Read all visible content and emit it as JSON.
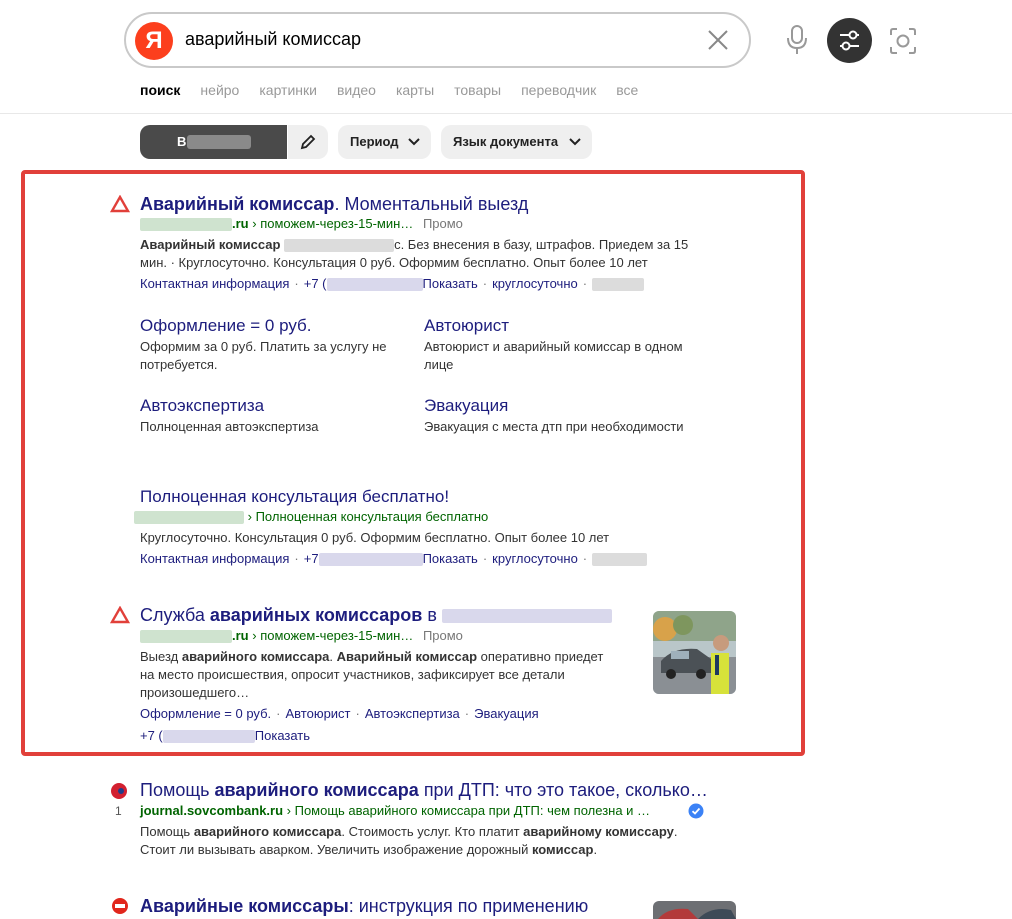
{
  "search": {
    "logo": "Я",
    "query": "аварийный комиссар"
  },
  "tabs": [
    "поиск",
    "нейро",
    "картинки",
    "видео",
    "карты",
    "товары",
    "переводчик",
    "все"
  ],
  "filters": {
    "region_prefix": "В",
    "period": "Период",
    "language": "Язык документа"
  },
  "ad1": {
    "title_bold": "Аварийный комиссар",
    "title_rest": ". Моментальный выезд",
    "url_domain_tail": ".ru",
    "url_path": "› поможем-через-15-мин…",
    "promo": "Промо",
    "text_bold": "Аварийный комиссар",
    "text_mid": "с. Без внесения в базу, штрафов. Приедем за 15",
    "text_line2": "мин. · Круглосуточно. Консультация 0 руб. Оформим бесплатно. Опыт более 10 лет",
    "contact": "Контактная информация",
    "phone_prefix": "+7 (",
    "show": "Показать",
    "hours": "круглосуточно",
    "sitelinks": [
      {
        "title": "Оформление = 0 руб.",
        "text": "Оформим за 0 руб. Платить за услугу не потребуется."
      },
      {
        "title": "Автоюрист",
        "text": "Автоюрист и аварийный комиссар в одном лице"
      },
      {
        "title": "Автоэкспертиза",
        "text": "Полноценная автоэкспертиза"
      },
      {
        "title": "Эвакуация",
        "text": "Эвакуация с места дтп при необходимости"
      }
    ]
  },
  "ad1b": {
    "title": "Полноценная консультация бесплатно!",
    "url_path": "› Полноценная консультация бесплатно",
    "text": "Круглосуточно. Консультация 0 руб. Оформим бесплатно. Опыт более 10 лет",
    "contact": "Контактная информация",
    "phone_prefix": "+7",
    "show": "Показать",
    "hours": "круглосуточно"
  },
  "ad2": {
    "title_pre": "Служба ",
    "title_bold": "аварийных комиссаров",
    "title_post": " в",
    "url_domain_tail": ".ru",
    "url_path": "› поможем-через-15-мин…",
    "promo": "Промо",
    "text_l1_a": "Выезд ",
    "text_l1_b": "аварийного комиссара",
    "text_l1_c": ". ",
    "text_l1_d": "Аварийный комиссар",
    "text_l1_e": " оперативно приедет",
    "text_l2": "на место происшествия, опросит участников, зафиксирует все детали",
    "text_l3": "произошедшего…",
    "links": [
      "Оформление = 0 руб.",
      "Автоюрист",
      "Автоэкспертиза",
      "Эвакуация"
    ],
    "phone_prefix": "+7 (",
    "show": "Показать"
  },
  "res3": {
    "rank": "1",
    "title_pre": "Помощь ",
    "title_bold": "аварийного комиссара",
    "title_post": " при ДТП: что это такое, сколько…",
    "url_domain": "journal.sovcombank.ru",
    "url_path": " › Помощь аварийного комиссара при ДТП: чем полезна и …",
    "t1_a": "Помощь ",
    "t1_b": "аварийного комиссара",
    "t1_c": ". Стоимость услуг. Кто платит ",
    "t1_d": "аварийному комиссару",
    "t1_e": ".",
    "t2_a": "Стоит ли вызывать аварком. Увеличить изображение дорожный ",
    "t2_b": "комиссар",
    "t2_c": "."
  },
  "res4": {
    "title_bold": "Аварийные комиссары",
    "title_rest": ": инструкция по применению"
  },
  "colors": {
    "brand": "#fc3f1d",
    "link": "#1d1d7d",
    "url": "#006400",
    "ad_border": "#e1403a"
  }
}
